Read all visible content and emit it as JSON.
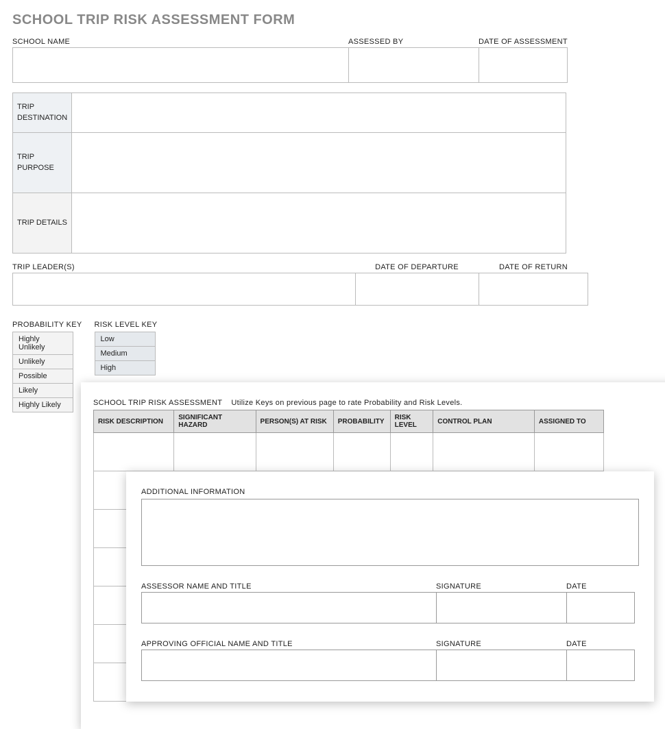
{
  "title": "SCHOOL TRIP RISK ASSESSMENT FORM",
  "header": {
    "school_name_label": "SCHOOL NAME",
    "assessed_by_label": "ASSESSED BY",
    "date_label": "DATE OF ASSESSMENT",
    "school_name": "",
    "assessed_by": "",
    "date": ""
  },
  "trip": {
    "destination_label": "TRIP DESTINATION",
    "purpose_label": "TRIP PURPOSE",
    "details_label": "TRIP DETAILS",
    "destination": "",
    "purpose": "",
    "details": ""
  },
  "leaders": {
    "leaders_label": "TRIP LEADER(S)",
    "departure_label": "DATE OF DEPARTURE",
    "return_label": "DATE OF RETURN",
    "leaders": "",
    "departure": "",
    "return": ""
  },
  "keys": {
    "prob_title": "PROBABILITY KEY",
    "risk_title": "RISK LEVEL KEY",
    "probability": [
      "Highly Unlikely",
      "Unlikely",
      "Possible",
      "Likely",
      "Highly Likely"
    ],
    "risk": [
      "Low",
      "Medium",
      "High"
    ]
  },
  "page2": {
    "heading": "SCHOOL TRIP RISK ASSESSMENT",
    "note": "Utilize Keys on previous page to rate Probability and Risk Levels.",
    "columns": [
      "RISK DESCRIPTION",
      "SIGNIFICANT HAZARD",
      "PERSON(S) AT RISK",
      "PROBABILITY",
      "RISK LEVEL",
      "CONTROL PLAN",
      "ASSIGNED TO"
    ]
  },
  "page3": {
    "additional_label": "ADDITIONAL INFORMATION",
    "assessor_label": "ASSESSOR NAME AND TITLE",
    "official_label": "APPROVING OFFICIAL NAME AND TITLE",
    "signature_label": "SIGNATURE",
    "date_label": "DATE"
  }
}
